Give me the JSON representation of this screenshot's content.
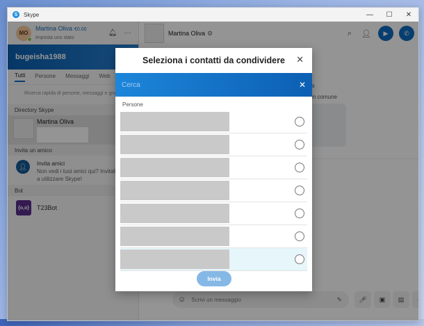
{
  "window": {
    "title": "Skype",
    "controls": {
      "minimize": "—",
      "maximize": "☐",
      "close": "✕"
    }
  },
  "sidebar": {
    "profile": {
      "initials": "MO",
      "name": "Martina Oliva",
      "credit": "€0.00",
      "status": "Imposta uno stato"
    },
    "banner": "bugeisha1988",
    "tabs": [
      "Tutti",
      "Persone",
      "Messaggi",
      "Web"
    ],
    "search_hint": "Ricerca rapida di persone, messaggi e gruppi",
    "sections": {
      "directory": "Directory Skype",
      "invite": "Invita un amico",
      "bot": "Bot"
    },
    "directory_item": {
      "name": "Martina Oliva"
    },
    "invite": {
      "title": "Invita amici",
      "desc": "Non vedi i tuoi amici qui? Invitali a utilizzare Skype!"
    },
    "bot": {
      "icon": "{o,o}",
      "name": "T23Bot"
    }
  },
  "chat": {
    "title": "Martina Oliva",
    "partial_text_1": "a",
    "partial_text_2": "in comune",
    "compose_placeholder": "Scrivi un messaggio"
  },
  "modal": {
    "title": "Seleziona i contatti da condividere",
    "search_placeholder": "Cerca",
    "people_label": "Persone",
    "send_label": "Invia",
    "rows": 7
  },
  "colors": {
    "accent": "#0f6cbf",
    "banner": "#1c6fc0",
    "send_button": "#86b8e6"
  }
}
